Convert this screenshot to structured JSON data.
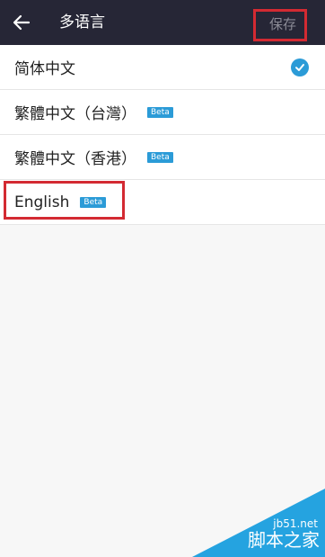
{
  "header": {
    "title": "多语言",
    "save_label": "保存"
  },
  "languages": [
    {
      "label": "简体中文",
      "beta": "",
      "selected": true
    },
    {
      "label": "繁體中文（台灣）",
      "beta": "Beta",
      "selected": false
    },
    {
      "label": "繁體中文（香港）",
      "beta": "Beta",
      "selected": false
    },
    {
      "label": "English",
      "beta": "Beta",
      "selected": false
    }
  ],
  "watermark": {
    "url": "jb51.net",
    "name": "脚本之家"
  },
  "colors": {
    "header_bg": "#262636",
    "accent": "#2b9bd7",
    "highlight": "#d32a32"
  }
}
